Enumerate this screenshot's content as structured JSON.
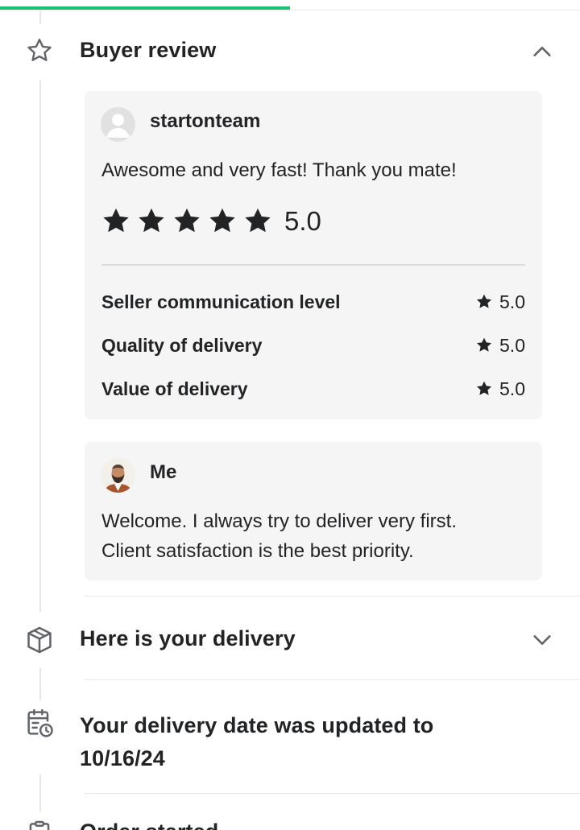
{
  "progress": {
    "fraction": 0.5
  },
  "buyer_review": {
    "title": "Buyer review",
    "icon": "star-outline-icon",
    "expanded": true,
    "review": {
      "username": "startonteam",
      "text": "Awesome and very fast! Thank you mate!",
      "stars": 5,
      "overall": "5.0",
      "breakdown": [
        {
          "label": "Seller communication level",
          "value": "5.0"
        },
        {
          "label": "Quality of delivery",
          "value": "5.0"
        },
        {
          "label": "Value of delivery",
          "value": "5.0"
        }
      ]
    },
    "response": {
      "username": "Me",
      "lines": [
        "Welcome. I always try to deliver very first.",
        "Client satisfaction is the best priority."
      ]
    }
  },
  "delivery": {
    "title": "Here is your delivery",
    "icon": "package-icon",
    "expanded": false
  },
  "date_update": {
    "title_line1": "Your delivery date was updated to",
    "title_line2": "10/16/24",
    "icon": "calendar-clock-icon"
  },
  "next_event": {
    "title": "Order started",
    "icon": "clipboard-icon"
  },
  "colors": {
    "accent": "#1dbf73",
    "card_bg": "#f5f5f5",
    "text": "#222325",
    "line": "#e4e5e7"
  }
}
